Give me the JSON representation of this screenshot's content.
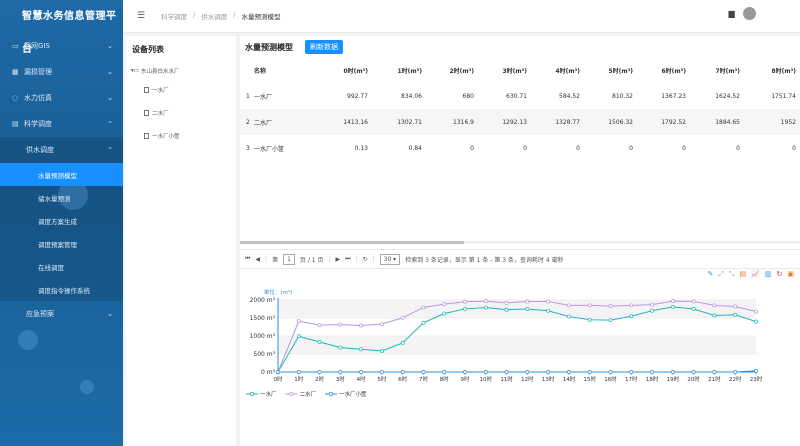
{
  "app": {
    "title": "智慧水务信息管理平台"
  },
  "sidebar": {
    "items": [
      {
        "label": "管网GIS",
        "icon": "monitor-icon"
      },
      {
        "label": "漏损管理",
        "icon": "grid-icon"
      },
      {
        "label": "水力仿真",
        "icon": "bulb-icon"
      },
      {
        "label": "科学调度",
        "icon": "clipboard-icon"
      }
    ],
    "dispatch_group": "供水调度",
    "dispatch_children": [
      "水量预测模型",
      "储水量预测",
      "调度方案生成",
      "调度预案管理",
      "在线调度",
      "调度指令操作系统"
    ],
    "emergency": "应急预案"
  },
  "topbar": {
    "breadcrumb": [
      "科学调度",
      "供水调度",
      "水量预测模型"
    ],
    "separator": "/"
  },
  "device_list": {
    "title": "设备列表",
    "root": "东山县白水水厂",
    "children": [
      "一水厂",
      "二水厂",
      "一水厂小筐"
    ]
  },
  "main": {
    "title": "水量预测模型",
    "refresh_label": "刷新数据"
  },
  "table": {
    "headers": [
      "名称",
      "0时(m³)",
      "1时(m³)",
      "2时(m³)",
      "3时(m³)",
      "4时(m³)",
      "5时(m³)",
      "6时(m³)",
      "7时(m³)",
      "8时(m³)"
    ],
    "rows": [
      {
        "index": "1",
        "cells": [
          "一水厂",
          "992.77",
          "834.06",
          "680",
          "630.71",
          "584.52",
          "810.32",
          "1367.23",
          "1624.52",
          "1751.74"
        ]
      },
      {
        "index": "2",
        "cells": [
          "二水厂",
          "1413.16",
          "1302.71",
          "1316.9",
          "1292.13",
          "1328.77",
          "1506.32",
          "1792.52",
          "1884.65",
          "1952"
        ]
      },
      {
        "index": "3",
        "cells": [
          "一水厂小筐",
          "0.13",
          "0.84",
          "0",
          "0",
          "0",
          "0",
          "0",
          "0",
          "0"
        ]
      }
    ]
  },
  "pager": {
    "page_prefix": "第",
    "page_value": "1",
    "page_suffix": "页 / 1 页",
    "page_size": "30",
    "summary": "检索到 3 条记录，显示 第 1 条 - 第 3 条，查询耗时 4 毫秒"
  },
  "colors": {
    "accent": "#1890ff",
    "series1": "#1fb5ba",
    "series2": "#b897e0",
    "series3": "#2f8fd6"
  },
  "chart_data": {
    "type": "line",
    "ylabel": "单位：(m³)",
    "ylim": [
      0,
      2000
    ],
    "yticks": [
      "0 m³",
      "500 m³",
      "1000 m³",
      "1500 m³",
      "2000 m³"
    ],
    "ytick_values": [
      0,
      500,
      1000,
      1500,
      2000
    ],
    "categories": [
      "0时",
      "1时",
      "2时",
      "3时",
      "4时",
      "5时",
      "6时",
      "7时",
      "8时",
      "9时",
      "10时",
      "11时",
      "12时",
      "13时",
      "14时",
      "15时",
      "16时",
      "17时",
      "18时",
      "19时",
      "20时",
      "21时",
      "22时",
      "23时"
    ],
    "series": [
      {
        "name": "一水厂",
        "values": [
          0,
          992.77,
          834.06,
          680,
          630.71,
          584.52,
          810.32,
          1367.23,
          1624.52,
          1751.74,
          1790,
          1730,
          1750,
          1700,
          1540,
          1450,
          1440,
          1550,
          1700,
          1810,
          1750,
          1570,
          1590,
          1400
        ]
      },
      {
        "name": "二水厂",
        "values": [
          0,
          1413.16,
          1302.71,
          1316.9,
          1292.13,
          1328.77,
          1506.32,
          1792.52,
          1884.65,
          1952,
          1970,
          1920,
          1960,
          1960,
          1850,
          1850,
          1830,
          1850,
          1870,
          1970,
          1960,
          1850,
          1820,
          1680
        ]
      },
      {
        "name": "一水厂小筐",
        "values": [
          0,
          0.13,
          0.84,
          0,
          0,
          0,
          0,
          0,
          0,
          0,
          0,
          0,
          0,
          0,
          0,
          0,
          0,
          0,
          0,
          0,
          0,
          0,
          0,
          30
        ]
      }
    ],
    "legend": "bottom-left",
    "grid": true
  }
}
